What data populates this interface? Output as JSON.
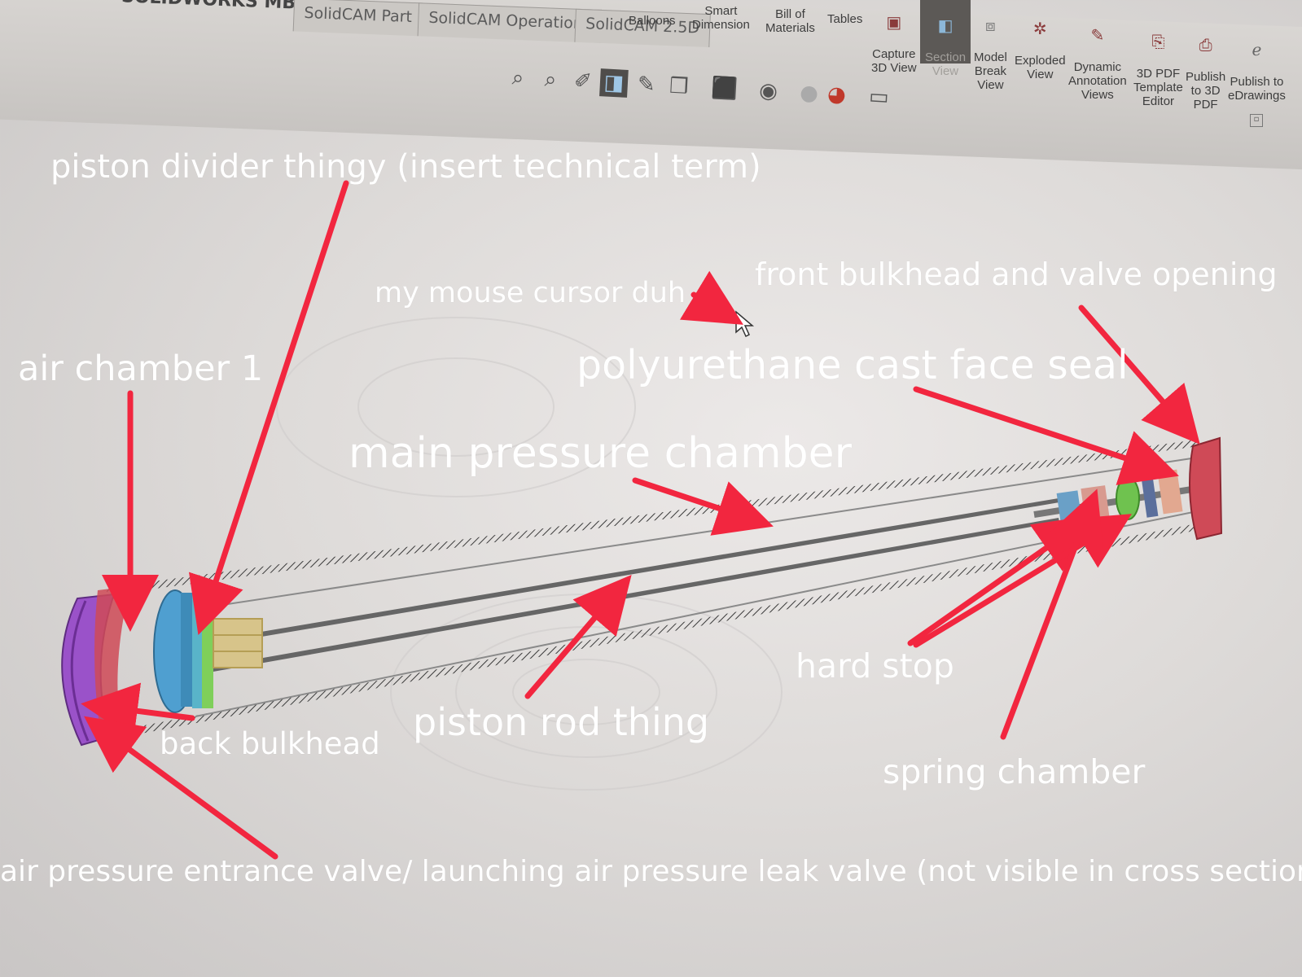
{
  "ribbon": {
    "tabs": [
      "SOLIDWORKS MBD",
      "SolidCAM Part",
      "SolidCAM Operations",
      "SolidCAM 2.5D"
    ],
    "tools": [
      {
        "label": "Balloons",
        "icon": "balloons-icon"
      },
      {
        "label": "Smart\nDimension",
        "icon": "dimension-icon"
      },
      {
        "label": "Bill of\nMaterials",
        "icon": "bom-icon"
      },
      {
        "label": "Tables",
        "icon": "tables-icon"
      },
      {
        "label": "Capture\n3D View",
        "icon": "capture-view-icon"
      },
      {
        "label": "Section\nView",
        "icon": "section-view-icon"
      },
      {
        "label": "Model\nBreak\nView",
        "icon": "model-break-icon"
      },
      {
        "label": "Exploded\nView",
        "icon": "exploded-view-icon"
      },
      {
        "label": "Dynamic\nAnnotation\nViews",
        "icon": "dynamic-annotation-icon"
      },
      {
        "label": "3D PDF\nTemplate\nEditor",
        "icon": "pdf-template-icon"
      },
      {
        "label": "Publish\nto 3D\nPDF",
        "icon": "publish-pdf-icon"
      },
      {
        "label": "Publish to\neDrawings",
        "icon": "edrawings-icon"
      }
    ]
  },
  "view_toolbar": [
    {
      "icon": "zoom-to-fit-icon"
    },
    {
      "icon": "zoom-area-icon"
    },
    {
      "icon": "previous-view-icon"
    },
    {
      "icon": "section-view-icon",
      "active": true
    },
    {
      "icon": "dynamic-annotation-icon"
    },
    {
      "icon": "view-orientation-icon"
    },
    {
      "icon": "display-style-icon"
    },
    {
      "icon": "hide-show-icon"
    },
    {
      "icon": "edit-appearance-icon"
    },
    {
      "icon": "apply-scene-icon"
    },
    {
      "icon": "view-settings-icon"
    }
  ],
  "annotations": {
    "piston_divider": "piston divider thingy  (insert technical term)",
    "mouse_cursor": "my mouse cursor duh",
    "front_bulkhead": "front bulkhead and valve opening",
    "air_chamber": "air chamber 1",
    "face_seal": "polyurethane cast face seal",
    "main_chamber": "main pressure chamber",
    "hard_stop": "hard stop",
    "piston_rod": "piston rod thing",
    "back_bulkhead": "back bulkhead",
    "spring_chamber": "spring chamber",
    "entrance_valve": "air pressure entrance valve/ launching air pressure leak valve (not visible in cross section)"
  },
  "colors": {
    "arrow": "#f2263f",
    "back_bulkhead": "#9a52c9",
    "piston_divider": "#4f9fd0",
    "piston_seal": "#7fcf5a",
    "rod_block": "#d7c48a",
    "front_bulkhead": "#cf4a57",
    "tube": "#4e4e4e"
  }
}
